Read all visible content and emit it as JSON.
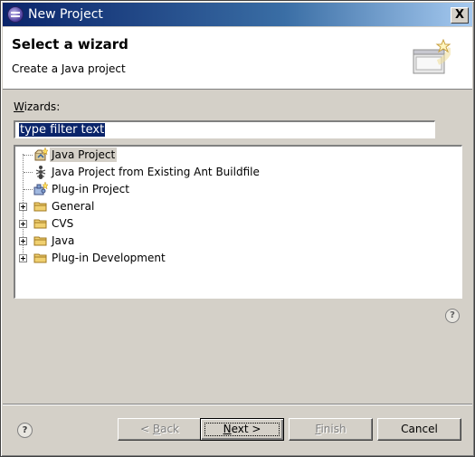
{
  "window": {
    "title": "New Project",
    "close_glyph": "X"
  },
  "header": {
    "title": "Select a wizard",
    "description": "Create a Java project"
  },
  "wizards_label": {
    "mnemonic": "W",
    "rest": "izards:"
  },
  "filter": {
    "value": "type filter text"
  },
  "tree": {
    "items": [
      {
        "label": "Java Project",
        "icon": "java-project-icon",
        "expandable": false,
        "selected": true
      },
      {
        "label": "Java Project from Existing Ant Buildfile",
        "icon": "ant-icon",
        "expandable": false
      },
      {
        "label": "Plug-in Project",
        "icon": "plugin-project-icon",
        "expandable": false
      },
      {
        "label": "General",
        "icon": "folder-icon",
        "expandable": true
      },
      {
        "label": "CVS",
        "icon": "folder-icon",
        "expandable": true
      },
      {
        "label": "Java",
        "icon": "folder-icon",
        "expandable": true
      },
      {
        "label": "Plug-in Development",
        "icon": "folder-icon",
        "expandable": true
      }
    ]
  },
  "help_glyph": "?",
  "buttons": {
    "back": {
      "prefix": "< ",
      "mnemonic": "B",
      "rest": "ack"
    },
    "next": {
      "mnemonic": "N",
      "rest": "ext >"
    },
    "finish": {
      "mnemonic": "F",
      "rest": "inish"
    },
    "cancel": "Cancel"
  },
  "colors": {
    "selection": "#0a246a",
    "title_start": "#0a246a",
    "title_end": "#a6caf0",
    "folder": "#e8c060"
  }
}
